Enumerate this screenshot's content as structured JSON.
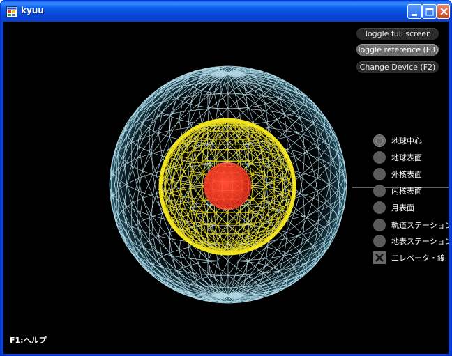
{
  "window": {
    "title": "kyuu",
    "icon": "app-window-icon",
    "controls": [
      "minimize-icon",
      "maximize-icon",
      "close-icon"
    ]
  },
  "buttons": [
    {
      "id": "toggle-full-screen",
      "label": "Toggle full screen",
      "active": false
    },
    {
      "id": "toggle-reference",
      "label": "Toggle reference (F3)",
      "active": true
    },
    {
      "id": "change-device",
      "label": "Change Device (F2)",
      "active": false
    }
  ],
  "view_options": [
    {
      "id": "earth-center",
      "label": "地球中心",
      "type": "radio",
      "checked": true
    },
    {
      "id": "earth-surface",
      "label": "地球表面",
      "type": "radio",
      "checked": false
    },
    {
      "id": "outer-core-surface",
      "label": "外核表面",
      "type": "radio",
      "checked": false
    },
    {
      "id": "inner-core-surface",
      "label": "内核表面",
      "type": "radio",
      "checked": false
    },
    {
      "id": "moon-surface",
      "label": "月表面",
      "type": "radio",
      "checked": false
    },
    {
      "id": "orbital-station",
      "label": "軌道ステーション",
      "type": "radio",
      "checked": false
    },
    {
      "id": "surface-station",
      "label": "地表ステーション",
      "type": "radio",
      "checked": false
    },
    {
      "id": "elevator-line",
      "label": "エレベータ・線",
      "type": "checkbox",
      "checked": true
    }
  ],
  "help": {
    "text": "F1:ヘルプ"
  },
  "colors": {
    "background": "#000000",
    "outer_sphere": "#bfe6f2",
    "middle_sphere": "#f0e21e",
    "inner_sphere": "#e0321c",
    "titlebar": "#0a5ded"
  }
}
